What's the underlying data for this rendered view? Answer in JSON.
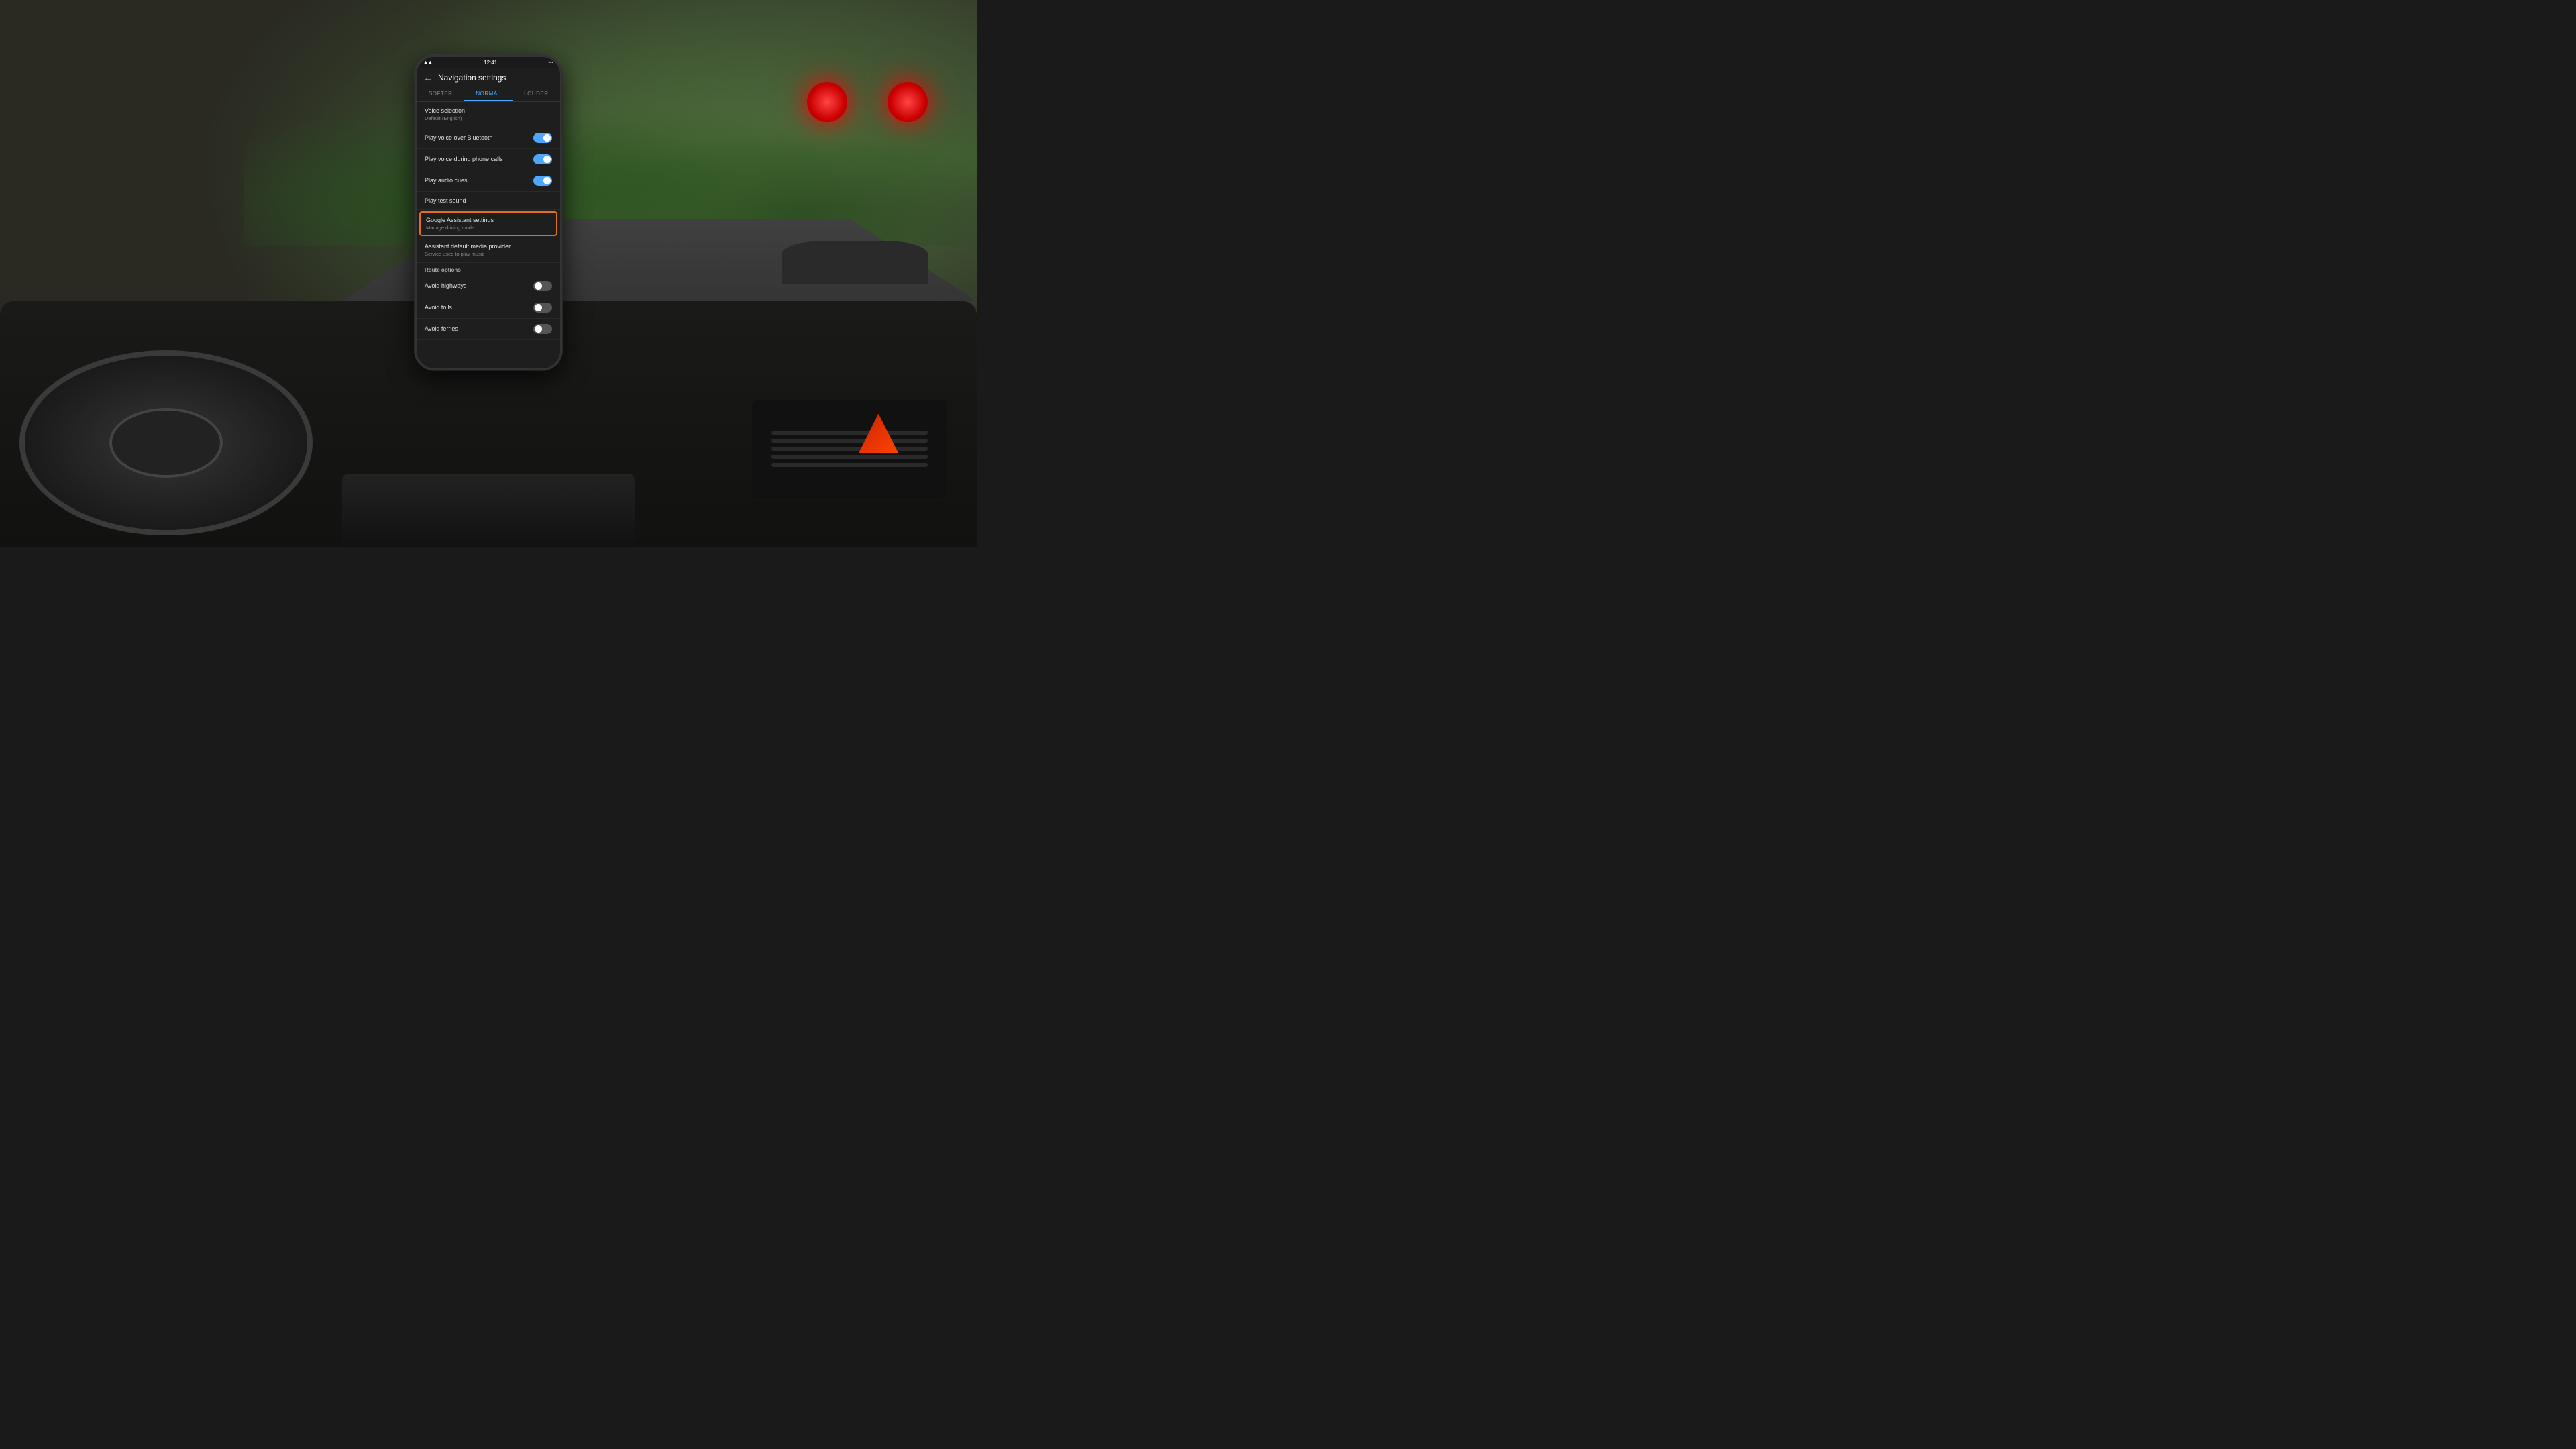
{
  "scene": {
    "background_color": "#2a2a22"
  },
  "phone": {
    "status_bar": {
      "signal": "▲▲",
      "wifi": "wifi",
      "time": "12:41",
      "battery_icons": "▪▪▪▪"
    },
    "header": {
      "back_label": "←",
      "title": "Navigation settings"
    },
    "volume_tabs": [
      {
        "label": "SOFTER",
        "active": false
      },
      {
        "label": "NORMAL",
        "active": true
      },
      {
        "label": "LOUDER",
        "active": false
      }
    ],
    "voice_selection": {
      "title": "Voice selection",
      "subtitle": "Default (English)"
    },
    "settings": [
      {
        "id": "play-voice-bluetooth",
        "title": "Play voice over Bluetooth",
        "subtitle": "",
        "toggle": true,
        "toggle_state": "on",
        "highlighted": false
      },
      {
        "id": "play-voice-phone-calls",
        "title": "Play voice during phone calls",
        "subtitle": "",
        "toggle": true,
        "toggle_state": "on",
        "highlighted": false
      },
      {
        "id": "play-audio-cues",
        "title": "Play audio cues",
        "subtitle": "",
        "toggle": true,
        "toggle_state": "on",
        "highlighted": false
      },
      {
        "id": "play-test-sound",
        "title": "Play test sound",
        "subtitle": "",
        "toggle": false,
        "highlighted": false
      },
      {
        "id": "google-assistant-settings",
        "title": "Google Assistant settings",
        "subtitle": "Manage driving mode",
        "toggle": false,
        "highlighted": true
      },
      {
        "id": "assistant-default-media",
        "title": "Assistant default media provider",
        "subtitle": "Service used to play music",
        "toggle": false,
        "highlighted": false
      }
    ],
    "route_options": {
      "section_title": "Route options",
      "items": [
        {
          "id": "avoid-highways",
          "title": "Avoid highways",
          "toggle": true,
          "toggle_state": "off"
        },
        {
          "id": "avoid-tolls",
          "title": "Avoid tolls",
          "toggle": true,
          "toggle_state": "off"
        },
        {
          "id": "avoid-ferries",
          "title": "Avoid ferries",
          "toggle": true,
          "toggle_state": "off"
        }
      ]
    }
  }
}
